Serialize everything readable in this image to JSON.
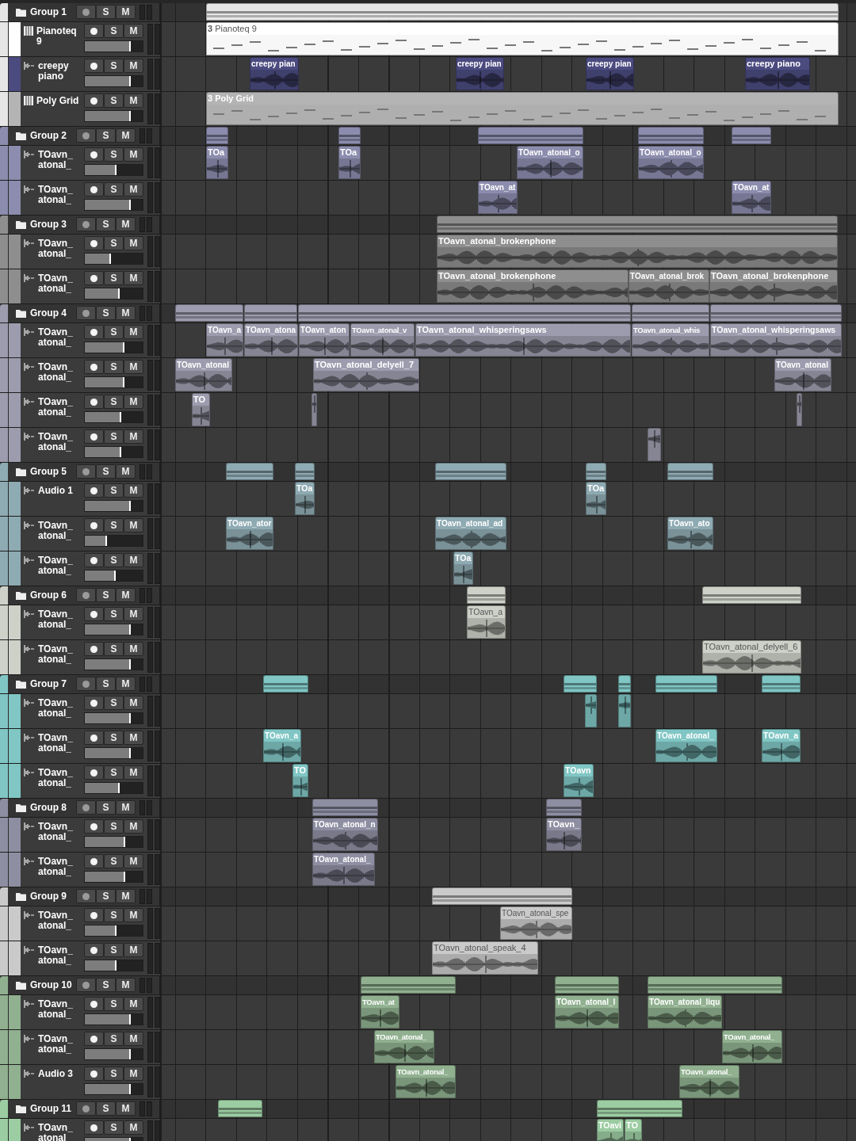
{
  "groups": [
    {
      "name": "Group 1",
      "solo": "S",
      "mute": "M",
      "color": "#e6e6e6",
      "clips": [
        {
          "kind": "summary"
        }
      ],
      "tracks": [
        {
          "name": "Pianoteq 9",
          "solo": "S",
          "mute": "M",
          "kind": "instrument",
          "color": "#ffffff",
          "level": 0.8,
          "clips": [
            {
              "kind": "midi",
              "name": "**3** Pianoteq 9"
            }
          ]
        },
        {
          "name": "creepy piano",
          "solo": "S",
          "mute": "M",
          "kind": "audio",
          "color": "#4b4b80",
          "level": 0.8,
          "clips": [
            {
              "kind": "audio",
              "name": "creepy pian"
            },
            {
              "kind": "audio",
              "name": "creepy pian"
            },
            {
              "kind": "audio",
              "name": "creepy pian"
            },
            {
              "kind": "audio",
              "name": "creepy piano"
            }
          ]
        },
        {
          "name": "Poly Grid",
          "solo": "S",
          "mute": "M",
          "kind": "instrument",
          "color": "#b4b4b4",
          "level": 0.8,
          "clips": [
            {
              "kind": "midi",
              "name": "**3** Poly Grid"
            }
          ]
        }
      ]
    },
    {
      "name": "Group 2",
      "solo": "S",
      "mute": "M",
      "color": "#8c8cae",
      "clips": [
        {
          "kind": "summary"
        },
        {
          "kind": "summary"
        },
        {
          "kind": "summary"
        },
        {
          "kind": "summary"
        },
        {
          "kind": "summary"
        }
      ],
      "tracks": [
        {
          "name": "TOavn_atonal_",
          "solo": "S",
          "mute": "M",
          "kind": "audio",
          "color": "#8c8cae",
          "level": 0.55,
          "clips": [
            {
              "kind": "audio",
              "name": "TOa"
            },
            {
              "kind": "audio",
              "name": "TOa"
            },
            {
              "kind": "audio",
              "name": "TOavn_atonal_o"
            },
            {
              "kind": "audio",
              "name": "TOavn_atonal_o"
            }
          ]
        },
        {
          "name": "TOavn_atonal_",
          "solo": "S",
          "mute": "M",
          "kind": "audio",
          "color": "#8c8cae",
          "level": 0.8,
          "clips": [
            {
              "kind": "audio",
              "name": "TOavn_at"
            },
            {
              "kind": "audio",
              "name": "TOavn_at"
            }
          ]
        }
      ]
    },
    {
      "name": "Group 3",
      "solo": "S",
      "mute": "M",
      "color": "#8e8e8e",
      "clips": [
        {
          "kind": "summary"
        }
      ],
      "tracks": [
        {
          "name": "TOavn_atonal_",
          "solo": "S",
          "mute": "M",
          "kind": "audio",
          "color": "#8e8e8e",
          "level": 0.45,
          "clips": [
            {
              "kind": "audio",
              "name": "TOavn_atonal_brokenphone"
            }
          ]
        },
        {
          "name": "TOavn_atonal_",
          "solo": "S",
          "mute": "M",
          "kind": "audio",
          "color": "#8e8e8e",
          "level": 0.6,
          "clips": [
            {
              "kind": "audio",
              "name": "TOavn_atonal_brokenphone"
            },
            {
              "kind": "audio",
              "name": "TOavn_atonal_brok"
            },
            {
              "kind": "audio",
              "name": "TOavn_atonal_brokenphone"
            }
          ]
        }
      ]
    },
    {
      "name": "Group 4",
      "solo": "S",
      "mute": "M",
      "color": "#9c9cae",
      "clips": [
        {
          "kind": "summary"
        },
        {
          "kind": "summary"
        },
        {
          "kind": "summary"
        },
        {
          "kind": "summary"
        },
        {
          "kind": "summary"
        }
      ],
      "tracks": [
        {
          "name": "TOavn_atonal_",
          "solo": "S",
          "mute": "M",
          "kind": "audio",
          "color": "#9c9cae",
          "level": 0.68,
          "clips": [
            {
              "kind": "audio",
              "name": "TOavn_a"
            },
            {
              "kind": "audio",
              "name": "TOavn_atona"
            },
            {
              "kind": "audio",
              "name": "TOavn_aton"
            },
            {
              "kind": "audio",
              "name": "TOavn_atonal_v"
            },
            {
              "kind": "audio",
              "name": "TOavn_atonal_whisperingsaws"
            },
            {
              "kind": "audio",
              "name": "TOavn_atonal_whis"
            },
            {
              "kind": "audio",
              "name": "TOavn_atonal_whisperingsaws"
            }
          ]
        },
        {
          "name": "TOavn_atonal_",
          "solo": "S",
          "mute": "M",
          "kind": "audio",
          "color": "#9c9cae",
          "level": 0.68,
          "clips": [
            {
              "kind": "audio",
              "name": "TOavn_atonal"
            },
            {
              "kind": "audio",
              "name": "TOavn_atonal_delyell_7"
            },
            {
              "kind": "audio",
              "name": "TOavn_atonal"
            }
          ]
        },
        {
          "name": "TOavn_atonal_",
          "solo": "S",
          "mute": "M",
          "kind": "audio",
          "color": "#9c9cae",
          "level": 0.63,
          "clips": [
            {
              "kind": "audio",
              "name": "TO"
            },
            {
              "kind": "audio"
            },
            {
              "kind": "audio"
            }
          ]
        },
        {
          "name": "TOavn_atonal_",
          "solo": "S",
          "mute": "M",
          "kind": "audio",
          "color": "#9c9cae",
          "level": 0.63,
          "clips": [
            {
              "kind": "audio"
            }
          ]
        }
      ]
    },
    {
      "name": "Group 5",
      "solo": "S",
      "mute": "M",
      "color": "#8eaab2",
      "clips": [
        {
          "kind": "summary"
        },
        {
          "kind": "summary"
        },
        {
          "kind": "summary"
        },
        {
          "kind": "summary"
        },
        {
          "kind": "summary"
        }
      ],
      "tracks": [
        {
          "name": "Audio 1",
          "solo": "S",
          "mute": "M",
          "kind": "audio",
          "color": "#8eaab2",
          "level": 0.8,
          "clips": [
            {
              "kind": "audio",
              "name": "TOa"
            },
            {
              "kind": "audio",
              "name": "TOa"
            }
          ]
        },
        {
          "name": "TOavn_atonal_",
          "solo": "S",
          "mute": "M",
          "kind": "audio",
          "color": "#8eaab2",
          "level": 0.38,
          "clips": [
            {
              "kind": "audio",
              "name": "TOavn_ator"
            },
            {
              "kind": "audio",
              "name": "TOavn_atonal_ad"
            },
            {
              "kind": "audio",
              "name": "TOavn_ato"
            }
          ]
        },
        {
          "name": "TOavn_atonal_",
          "solo": "S",
          "mute": "M",
          "kind": "audio",
          "color": "#8eaab2",
          "level": 0.53,
          "clips": [
            {
              "kind": "audio",
              "name": "TOa"
            }
          ]
        }
      ]
    },
    {
      "name": "Group 6",
      "solo": "S",
      "mute": "M",
      "color": "#cdd1c8",
      "clips": [
        {
          "kind": "summary"
        },
        {
          "kind": "summary"
        }
      ],
      "tracks": [
        {
          "name": "TOavn_atonal_",
          "solo": "S",
          "mute": "M",
          "kind": "audio",
          "color": "#cdd1c8",
          "level": 0.8,
          "clips": [
            {
              "kind": "audio",
              "name": "TOavn_a"
            }
          ]
        },
        {
          "name": "TOavn_atonal_",
          "solo": "S",
          "mute": "M",
          "kind": "audio",
          "color": "#cdd1c8",
          "level": 0.8,
          "clips": [
            {
              "kind": "audio",
              "name": "TOavn_atonal_delyell_6"
            }
          ]
        }
      ]
    },
    {
      "name": "Group 7",
      "solo": "S",
      "mute": "M",
      "color": "#80c6c4",
      "clips": [
        {
          "kind": "summary"
        },
        {
          "kind": "summary"
        },
        {
          "kind": "summary"
        },
        {
          "kind": "summary"
        },
        {
          "kind": "summary"
        }
      ],
      "tracks": [
        {
          "name": "TOavn_atonal_",
          "solo": "S",
          "mute": "M",
          "kind": "audio",
          "color": "#80c6c4",
          "level": 0.8,
          "clips": [
            {
              "kind": "audio"
            },
            {
              "kind": "audio"
            }
          ]
        },
        {
          "name": "TOavn_atonal_",
          "solo": "S",
          "mute": "M",
          "kind": "audio",
          "color": "#80c6c4",
          "level": 0.8,
          "clips": [
            {
              "kind": "audio",
              "name": "TOavn_a"
            },
            {
              "kind": "audio",
              "name": "TOavn_atonal_"
            },
            {
              "kind": "audio",
              "name": "TOavn_a"
            }
          ]
        },
        {
          "name": "TOavn_atonal_",
          "solo": "S",
          "mute": "M",
          "kind": "audio",
          "color": "#80c6c4",
          "level": 0.6,
          "clips": [
            {
              "kind": "audio",
              "name": "TO"
            },
            {
              "kind": "audio",
              "name": "TOavn"
            }
          ]
        }
      ]
    },
    {
      "name": "Group 8",
      "solo": "S",
      "mute": "M",
      "color": "#8e8ea2",
      "clips": [
        {
          "kind": "summary"
        },
        {
          "kind": "summary"
        }
      ],
      "tracks": [
        {
          "name": "TOavn_atonal_",
          "solo": "S",
          "mute": "M",
          "kind": "audio",
          "color": "#8e8ea2",
          "level": 0.7,
          "clips": [
            {
              "kind": "audio",
              "name": "TOavn_atonal_n"
            },
            {
              "kind": "audio",
              "name": "TOavn_"
            }
          ]
        },
        {
          "name": "TOavn_atonal_",
          "solo": "S",
          "mute": "M",
          "kind": "audio",
          "color": "#8e8ea2",
          "level": 0.7,
          "clips": [
            {
              "kind": "audio",
              "name": "TOavn_atonal_"
            }
          ]
        }
      ]
    },
    {
      "name": "Group 9",
      "solo": "S",
      "mute": "M",
      "color": "#cacaca",
      "clips": [
        {
          "kind": "summary"
        }
      ],
      "tracks": [
        {
          "name": "TOavn_atonal_",
          "solo": "S",
          "mute": "M",
          "kind": "audio",
          "color": "#cacaca",
          "level": 0.55,
          "clips": [
            {
              "kind": "audio",
              "name": "TOavn_atonal_spe"
            }
          ]
        },
        {
          "name": "TOavn_atonal_",
          "solo": "S",
          "mute": "M",
          "kind": "audio",
          "color": "#cacaca",
          "level": 0.55,
          "clips": [
            {
              "kind": "audio",
              "name": "TOavn_atonal_speak_4"
            }
          ]
        }
      ]
    },
    {
      "name": "Group 10",
      "solo": "S",
      "mute": "M",
      "color": "#90b090",
      "clips": [
        {
          "kind": "summary"
        },
        {
          "kind": "summary"
        },
        {
          "kind": "summary"
        }
      ],
      "tracks": [
        {
          "name": "TOavn_atonal_",
          "solo": "S",
          "mute": "M",
          "kind": "audio",
          "color": "#90b090",
          "level": 0.8,
          "clips": [
            {
              "kind": "audio",
              "name": "TOavn_at"
            },
            {
              "kind": "audio",
              "name": "TOavn_atonal_l"
            },
            {
              "kind": "audio",
              "name": "TOavn_atonal_liqu"
            }
          ]
        },
        {
          "name": "TOavn_atonal_",
          "solo": "S",
          "mute": "M",
          "kind": "audio",
          "color": "#90b090",
          "level": 0.8,
          "clips": [
            {
              "kind": "audio",
              "name": "TOavn_atonal_"
            },
            {
              "kind": "audio",
              "name": "TOavn_atonal_"
            }
          ]
        },
        {
          "name": "Audio 3",
          "solo": "S",
          "mute": "M",
          "kind": "audio",
          "color": "#90b090",
          "level": 0.8,
          "clips": [
            {
              "kind": "audio",
              "name": "TOavn_atonal_"
            },
            {
              "kind": "audio",
              "name": "TOavn_atonal_"
            }
          ]
        }
      ]
    },
    {
      "name": "Group 11",
      "solo": "S",
      "mute": "M",
      "color": "#9ccca2",
      "clips": [
        {
          "kind": "summary"
        },
        {
          "kind": "summary"
        }
      ],
      "tracks": [
        {
          "name": "TOavn_atonal",
          "solo": "S",
          "mute": "M",
          "kind": "audio",
          "color": "#9ccca2",
          "level": 0.8,
          "clips": [
            {
              "kind": "audio",
              "name": "TOavi"
            },
            {
              "kind": "audio",
              "name": "TO"
            }
          ]
        }
      ]
    }
  ]
}
